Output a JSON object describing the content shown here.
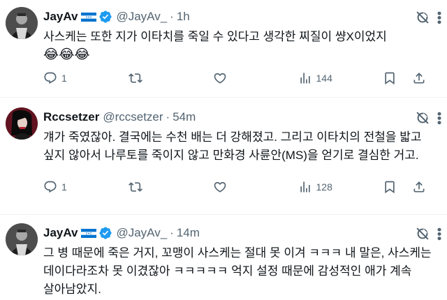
{
  "tweets": [
    {
      "name": "JayAv",
      "handle": "@JayAv_",
      "sep": "·",
      "time": "1h",
      "text": "사스케는 또한 지가 이타치를 죽일 수 있다고 생각한 찌질이 썅X이었지",
      "emojis": "😂😂😂",
      "replies": "1",
      "reposts": "",
      "likes": "",
      "views": "144"
    },
    {
      "name": "Rccsetzer",
      "handle": "@rccsetzer",
      "sep": "·",
      "time": "54m",
      "text": "걔가 죽였잖아. 결국에는 수천 배는 더 강해졌고. 그리고 이타치의 전철을 밟고 싶지 않아서 나루토를 죽이지 않고 만화경 사륜안(MS)을 얻기로 결심한 거고.",
      "replies": "1",
      "reposts": "",
      "likes": "",
      "views": "128"
    },
    {
      "name": "JayAv",
      "handle": "@JayAv_",
      "sep": "·",
      "time": "14m",
      "text": "그 병 때문에 죽은 거지, 꼬맹이 사스케는 절대 못 이겨 ㅋㅋㅋ 내 말은, 사스케는 데이다라조차 못 이겼잖아 ㅋㅋㅋㅋㅋ 억지 설정 때문에 감성적인 애가 계속 살아남았지."
    }
  ],
  "icons": {
    "verified": "verified-badge-icon",
    "flag": "honduras-flag-icon",
    "grok": "grok-icon",
    "more": "more-options-icon",
    "reply": "reply-icon",
    "repost": "repost-icon",
    "like": "like-icon",
    "views": "views-icon",
    "bookmark": "bookmark-icon",
    "share": "share-icon"
  },
  "colors": {
    "verified": "#1d9bf0",
    "flag_blue": "#0073cf",
    "muted": "#536471",
    "text": "#0f1419"
  }
}
